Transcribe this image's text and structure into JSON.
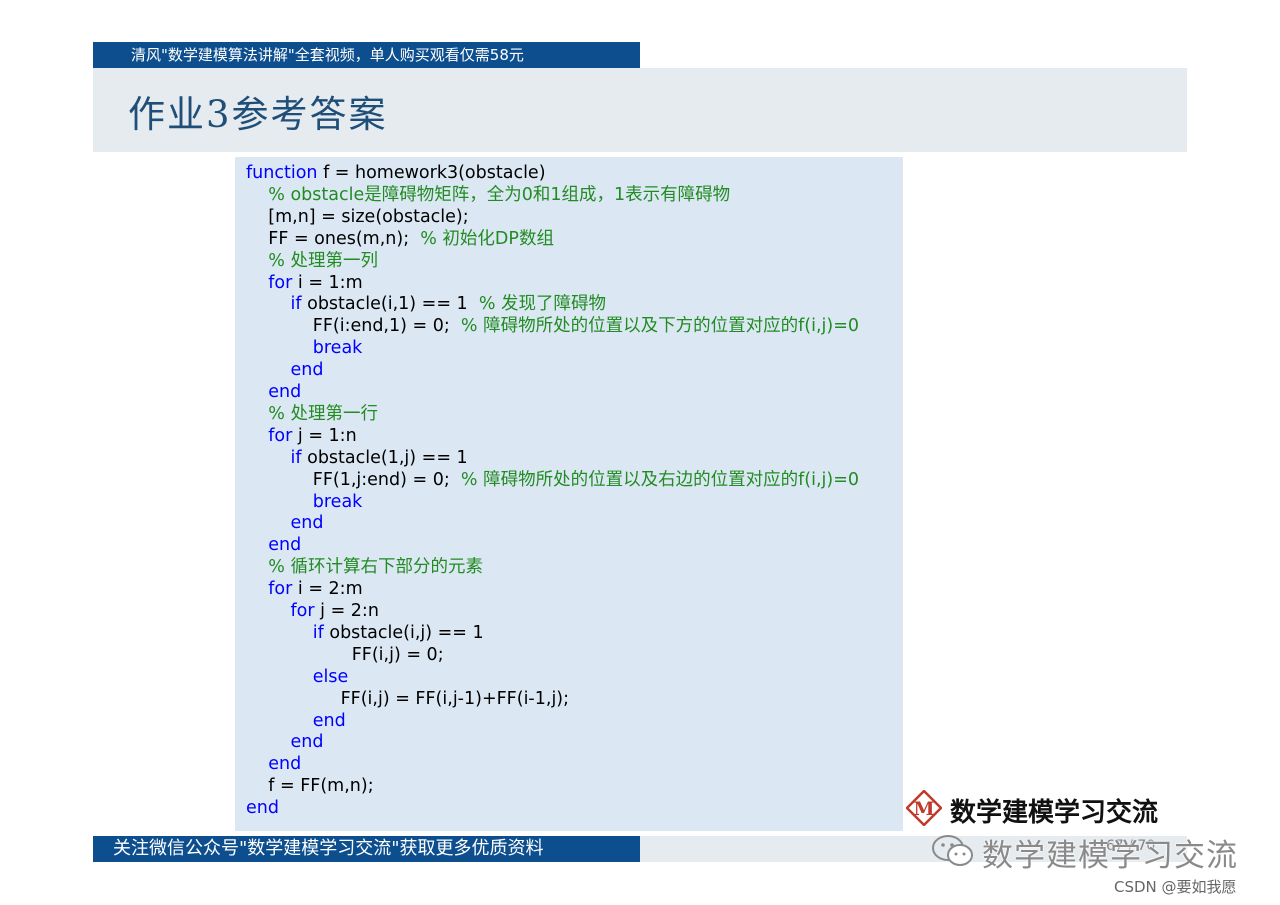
{
  "header": {
    "banner_text": "清风\"数学建模算法讲解\"全套视频，单人购买观看仅需58元",
    "title": "作业3参考答案"
  },
  "code": {
    "lines": [
      [
        "function",
        " f = homework3(obstacle)",
        ""
      ],
      [
        "",
        "    ",
        "% obstacle是障碍物矩阵，全为0和1组成，1表示有障碍物"
      ],
      [
        "",
        "    [m,n] = size(obstacle);",
        ""
      ],
      [
        "",
        "    FF = ones(m,n);  ",
        "% 初始化DP数组"
      ],
      [
        "",
        "    ",
        "% 处理第一列"
      ],
      [
        "for",
        " i = 1:m",
        ""
      ],
      [
        "if",
        " obstacle(i,1) == 1  ",
        "% 发现了障碍物"
      ],
      [
        "",
        "            FF(i:end,1) = 0;  ",
        "% 障碍物所处的位置以及下方的位置对应的f(i,j)=0"
      ],
      [
        "break",
        "",
        ""
      ],
      [
        "end",
        "",
        ""
      ],
      [
        "end",
        "",
        ""
      ],
      [
        "",
        "    ",
        "% 处理第一行"
      ],
      [
        "for",
        " j = 1:n",
        ""
      ],
      [
        "if",
        " obstacle(1,j) == 1",
        ""
      ],
      [
        "",
        "            FF(1,j:end) = 0;  ",
        "% 障碍物所处的位置以及右边的位置对应的f(i,j)=0"
      ],
      [
        "break",
        "",
        ""
      ],
      [
        "end",
        "",
        ""
      ],
      [
        "end",
        "",
        ""
      ],
      [
        "",
        "    ",
        "% 循环计算右下部分的元素"
      ],
      [
        "for",
        " i = 2:m",
        ""
      ],
      [
        "for",
        " j = 2:n",
        ""
      ],
      [
        "if",
        " obstacle(i,j) == 1",
        ""
      ],
      [
        "",
        "                   FF(i,j) = 0;",
        ""
      ],
      [
        "else",
        "",
        ""
      ],
      [
        "",
        "                 FF(i,j) = FF(i,j-1)+FF(i-1,j);",
        ""
      ],
      [
        "end",
        "",
        ""
      ],
      [
        "end",
        "",
        ""
      ],
      [
        "end",
        "",
        ""
      ],
      [
        "",
        "    f = FF(m,n);",
        ""
      ],
      [
        "end",
        "",
        ""
      ]
    ]
  },
  "footer": {
    "banner_text": "关注微信公众号\"数学建模学习交流\"获取更多优质资料",
    "page_number": "67 / 70",
    "logo_letter": "M",
    "logo_text": "数学建模学习交流",
    "watermark_text": "数学建模学习交流",
    "csdn_text": "CSDN @要如我愿"
  },
  "colors": {
    "banner_blue": "#0d4f8e",
    "title_band": "#e5ebee",
    "code_bg": "#dbe8f4",
    "keyword": "#0000ff",
    "comment": "#228b22",
    "title_text": "#1f4e79",
    "logo_red": "#c0392b"
  },
  "icons": [
    "wechat-icon",
    "m-logo-icon"
  ]
}
